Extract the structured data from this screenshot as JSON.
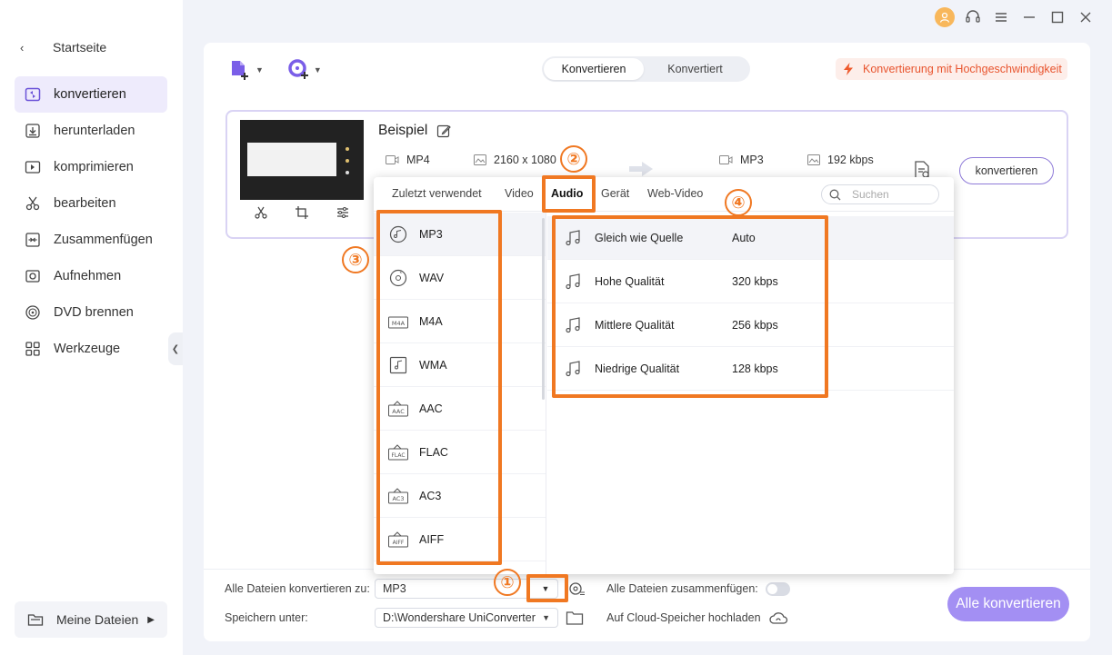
{
  "sidebar": {
    "home_label": "Startseite",
    "items": [
      {
        "label": "konvertieren",
        "icon": "convert-icon"
      },
      {
        "label": "herunterladen",
        "icon": "download-icon"
      },
      {
        "label": "komprimieren",
        "icon": "compress-icon"
      },
      {
        "label": "bearbeiten",
        "icon": "scissors-icon"
      },
      {
        "label": "Zusammenfügen",
        "icon": "merge-icon"
      },
      {
        "label": "Aufnehmen",
        "icon": "record-icon"
      },
      {
        "label": "DVD brennen",
        "icon": "dvd-icon"
      },
      {
        "label": "Werkzeuge",
        "icon": "tools-icon"
      }
    ],
    "active_index": 0,
    "my_files_label": "Meine Dateien"
  },
  "header": {
    "mode_tabs": [
      "Konvertieren",
      "Konvertiert"
    ],
    "active_mode": "Konvertieren",
    "speed_label": "Konvertierung mit Hochgeschwindigkeit"
  },
  "file": {
    "name": "Beispiel",
    "source_format": "MP4",
    "source_resolution": "2160 x 1080",
    "target_format": "MP3",
    "target_bitrate": "192 kbps",
    "convert_label": "konvertieren"
  },
  "popup": {
    "tabs": [
      "Zuletzt verwendet",
      "Video",
      "Audio",
      "Gerät",
      "Web-Video"
    ],
    "active_tab": "Audio",
    "search_placeholder": "Suchen",
    "formats": [
      {
        "label": "MP3",
        "icon": "mp3-disc-icon"
      },
      {
        "label": "WAV",
        "icon": "wav-disc-icon"
      },
      {
        "label": "M4A",
        "icon": "m4a-icon"
      },
      {
        "label": "WMA",
        "icon": "wma-icon"
      },
      {
        "label": "AAC",
        "icon": "aac-icon"
      },
      {
        "label": "FLAC",
        "icon": "flac-icon"
      },
      {
        "label": "AC3",
        "icon": "ac3-icon"
      },
      {
        "label": "AIFF",
        "icon": "aiff-icon"
      }
    ],
    "selected_format": "MP3",
    "qualities": [
      {
        "name": "Gleich wie Quelle",
        "value": "Auto"
      },
      {
        "name": "Hohe Qualität",
        "value": "320 kbps"
      },
      {
        "name": "Mittlere Qualität",
        "value": "256 kbps"
      },
      {
        "name": "Niedrige Qualität",
        "value": "128 kbps"
      }
    ]
  },
  "bottom": {
    "convert_all_to_label": "Alle Dateien konvertieren zu:",
    "convert_all_to_value": "MP3",
    "save_to_label": "Speichern unter:",
    "save_to_value": "D:\\Wondershare UniConverter",
    "merge_all_label": "Alle Dateien zusammenfügen:",
    "merge_all_on": false,
    "cloud_label": "Auf Cloud-Speicher hochladen",
    "convert_all_button": "Alle konvertieren"
  },
  "annotations": {
    "color": "#f07822",
    "badges": [
      "①",
      "②",
      "③",
      "④"
    ]
  },
  "colors": {
    "accent": "#a38ff3",
    "active_nav_bg": "#eeebfc",
    "speed_text": "#e8542e"
  }
}
